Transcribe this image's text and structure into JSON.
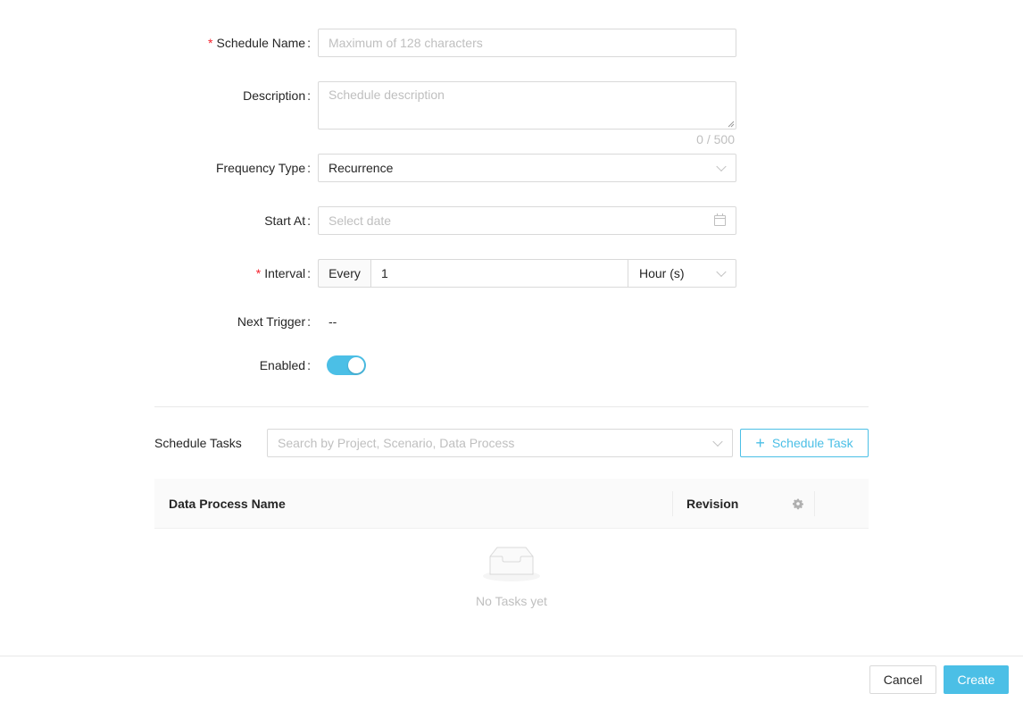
{
  "form": {
    "schedule_name": {
      "label": "Schedule Name",
      "required": true,
      "value": "",
      "placeholder": "Maximum of 128 characters"
    },
    "description": {
      "label": "Description",
      "required": false,
      "value": "",
      "placeholder": "Schedule description",
      "counter": "0 / 500"
    },
    "frequency_type": {
      "label": "Frequency Type",
      "value": "Recurrence"
    },
    "start_at": {
      "label": "Start At",
      "value": "",
      "placeholder": "Select date"
    },
    "interval": {
      "label": "Interval",
      "required": true,
      "prefix": "Every",
      "value": "1",
      "unit": "Hour (s)"
    },
    "next_trigger": {
      "label": "Next Trigger",
      "value": "--"
    },
    "enabled": {
      "label": "Enabled",
      "value": true
    }
  },
  "colon": ":",
  "required_mark": "*",
  "tasks": {
    "label": "Schedule Tasks",
    "search_placeholder": "Search by Project, Scenario, Data Process",
    "add_button": "Schedule Task",
    "add_icon": "+",
    "columns": [
      "Data Process Name",
      "Revision"
    ],
    "rows": [],
    "empty_text": "No Tasks yet"
  },
  "footer": {
    "cancel_label": "Cancel",
    "create_label": "Create"
  },
  "colors": {
    "accent": "#4bbfe6",
    "required": "#f5222d"
  }
}
